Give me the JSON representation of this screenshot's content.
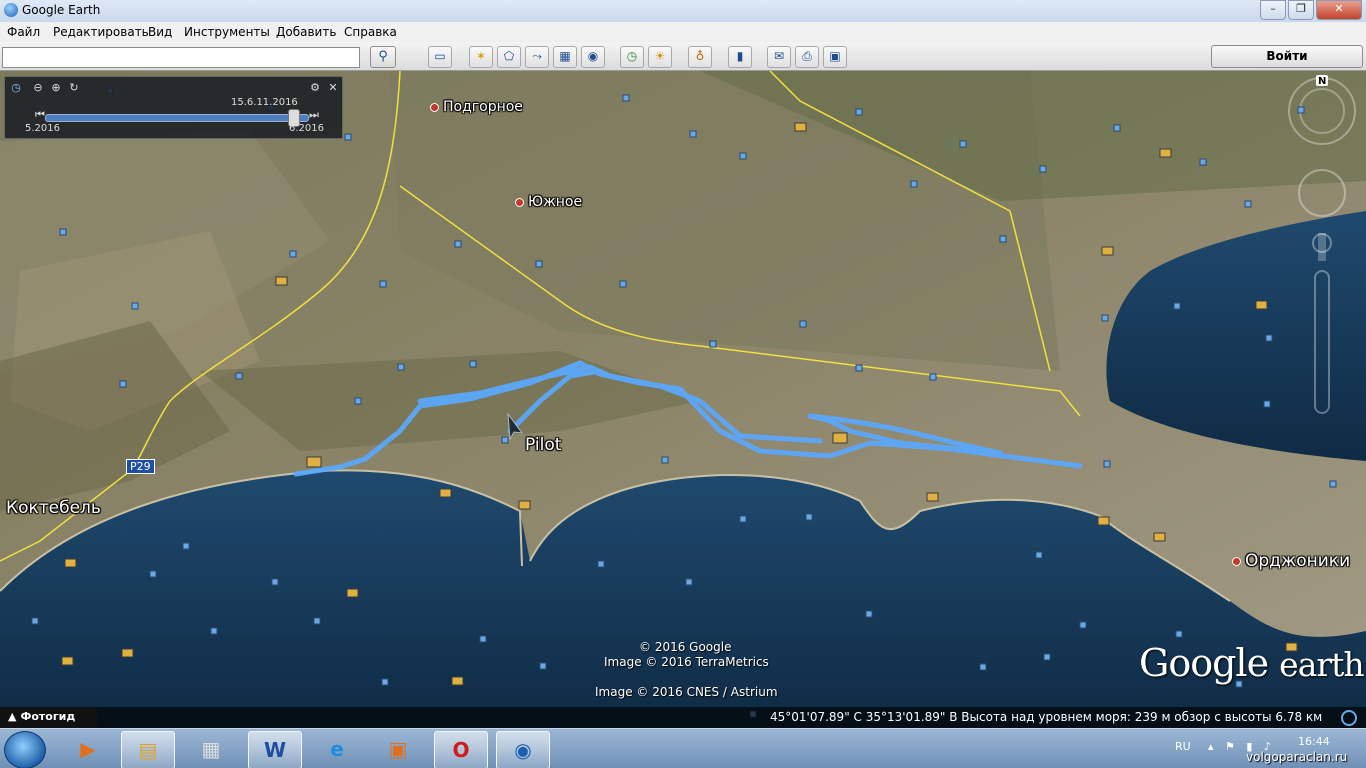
{
  "window": {
    "title": "Google Earth"
  },
  "menu": [
    "Файл",
    "Редактировать",
    "Вид",
    "Инструменты",
    "Добавить",
    "Справка"
  ],
  "toolbar": {
    "search_value": "",
    "login_label": "Войти"
  },
  "icons": {
    "search": "magnifier-icon",
    "sidebar": "sidebar-toggle-icon",
    "placemark": "placemark-icon",
    "polygon": "polygon-icon",
    "path": "path-icon",
    "overlay": "image-overlay-icon",
    "record": "record-tour-icon",
    "history": "historical-imagery-icon",
    "sun": "sun-icon",
    "planets": "planets-icon",
    "ruler": "ruler-icon",
    "email": "email-icon",
    "print": "print-icon",
    "maps": "google-maps-icon"
  },
  "timeslider": {
    "current_date": "15.6.11.2016",
    "start_label": "5.2016",
    "end_label": "6.2016"
  },
  "map": {
    "places": [
      {
        "label": "Подгорное"
      },
      {
        "label": "Южное"
      },
      {
        "label": "Pilot"
      },
      {
        "label": "Коктебель"
      },
      {
        "label": "Орджоники"
      },
      {
        "label": "P29"
      }
    ],
    "compass": "N",
    "track_color": "#5aa9ff",
    "road_color": "#f0e040"
  },
  "attribution": {
    "line1": "© 2016 Google",
    "line2": "Image © 2016 TerraMetrics",
    "line3": "Image © 2016 CNES / Astrium"
  },
  "logo": {
    "google": "Google",
    "earth": "earth"
  },
  "statusbar": {
    "tour_label": "Фотогид",
    "coords": "45°01'07.89\" С   35°13'01.89\" В  Высота над уровнем моря:   239 м      обзор с высоты   6.78 км"
  },
  "taskbar": {
    "lang": "RU",
    "time": "16:44"
  },
  "watermark": "volgoparaclan.ru"
}
